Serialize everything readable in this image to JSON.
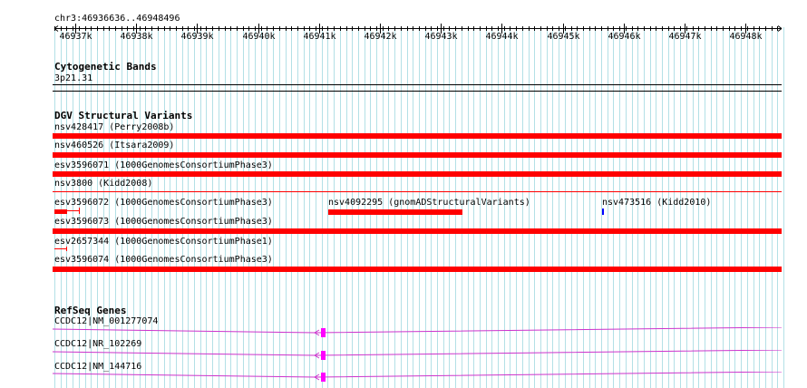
{
  "locus": "chr3:46936636..46948496",
  "ruler": {
    "ticks": [
      "46937k",
      "46938k",
      "46939k",
      "46940k",
      "46941k",
      "46942k",
      "46943k",
      "46944k",
      "46945k",
      "46946k",
      "46947k",
      "46948k"
    ]
  },
  "colors": {
    "grid_line": "#b3e0e6",
    "feature_red": "#ff0000",
    "variant_blue": "#0000ff",
    "gene_line": "#cc33cc",
    "exon": "#ff00ff"
  },
  "cytoband": {
    "title": "Cytogenetic Bands",
    "label": "3p21.31"
  },
  "dgv": {
    "title": "DGV Structural Variants",
    "features": [
      {
        "label": "nsv428417 (Perry2008b)"
      },
      {
        "label": "nsv460526 (Itsara2009)"
      },
      {
        "label": "esv3596071 (1000GenomesConsortiumPhase3)"
      },
      {
        "label": "nsv3800 (Kidd2008)"
      },
      {
        "label": "esv3596072 (1000GenomesConsortiumPhase3)"
      },
      {
        "label": "nsv4092295 (gnomADStructuralVariants)"
      },
      {
        "label": "nsv473516 (Kidd2010)"
      },
      {
        "label": "esv3596073 (1000GenomesConsortiumPhase3)"
      },
      {
        "label": "esv2657344 (1000GenomesConsortiumPhase1)"
      },
      {
        "label": "esv3596074 (1000GenomesConsortiumPhase3)"
      }
    ]
  },
  "refseq": {
    "title": "RefSeq Genes",
    "genes": [
      {
        "label": "CCDC12|NM_001277074"
      },
      {
        "label": "CCDC12|NR_102269"
      },
      {
        "label": "CCDC12|NM_144716"
      }
    ]
  }
}
